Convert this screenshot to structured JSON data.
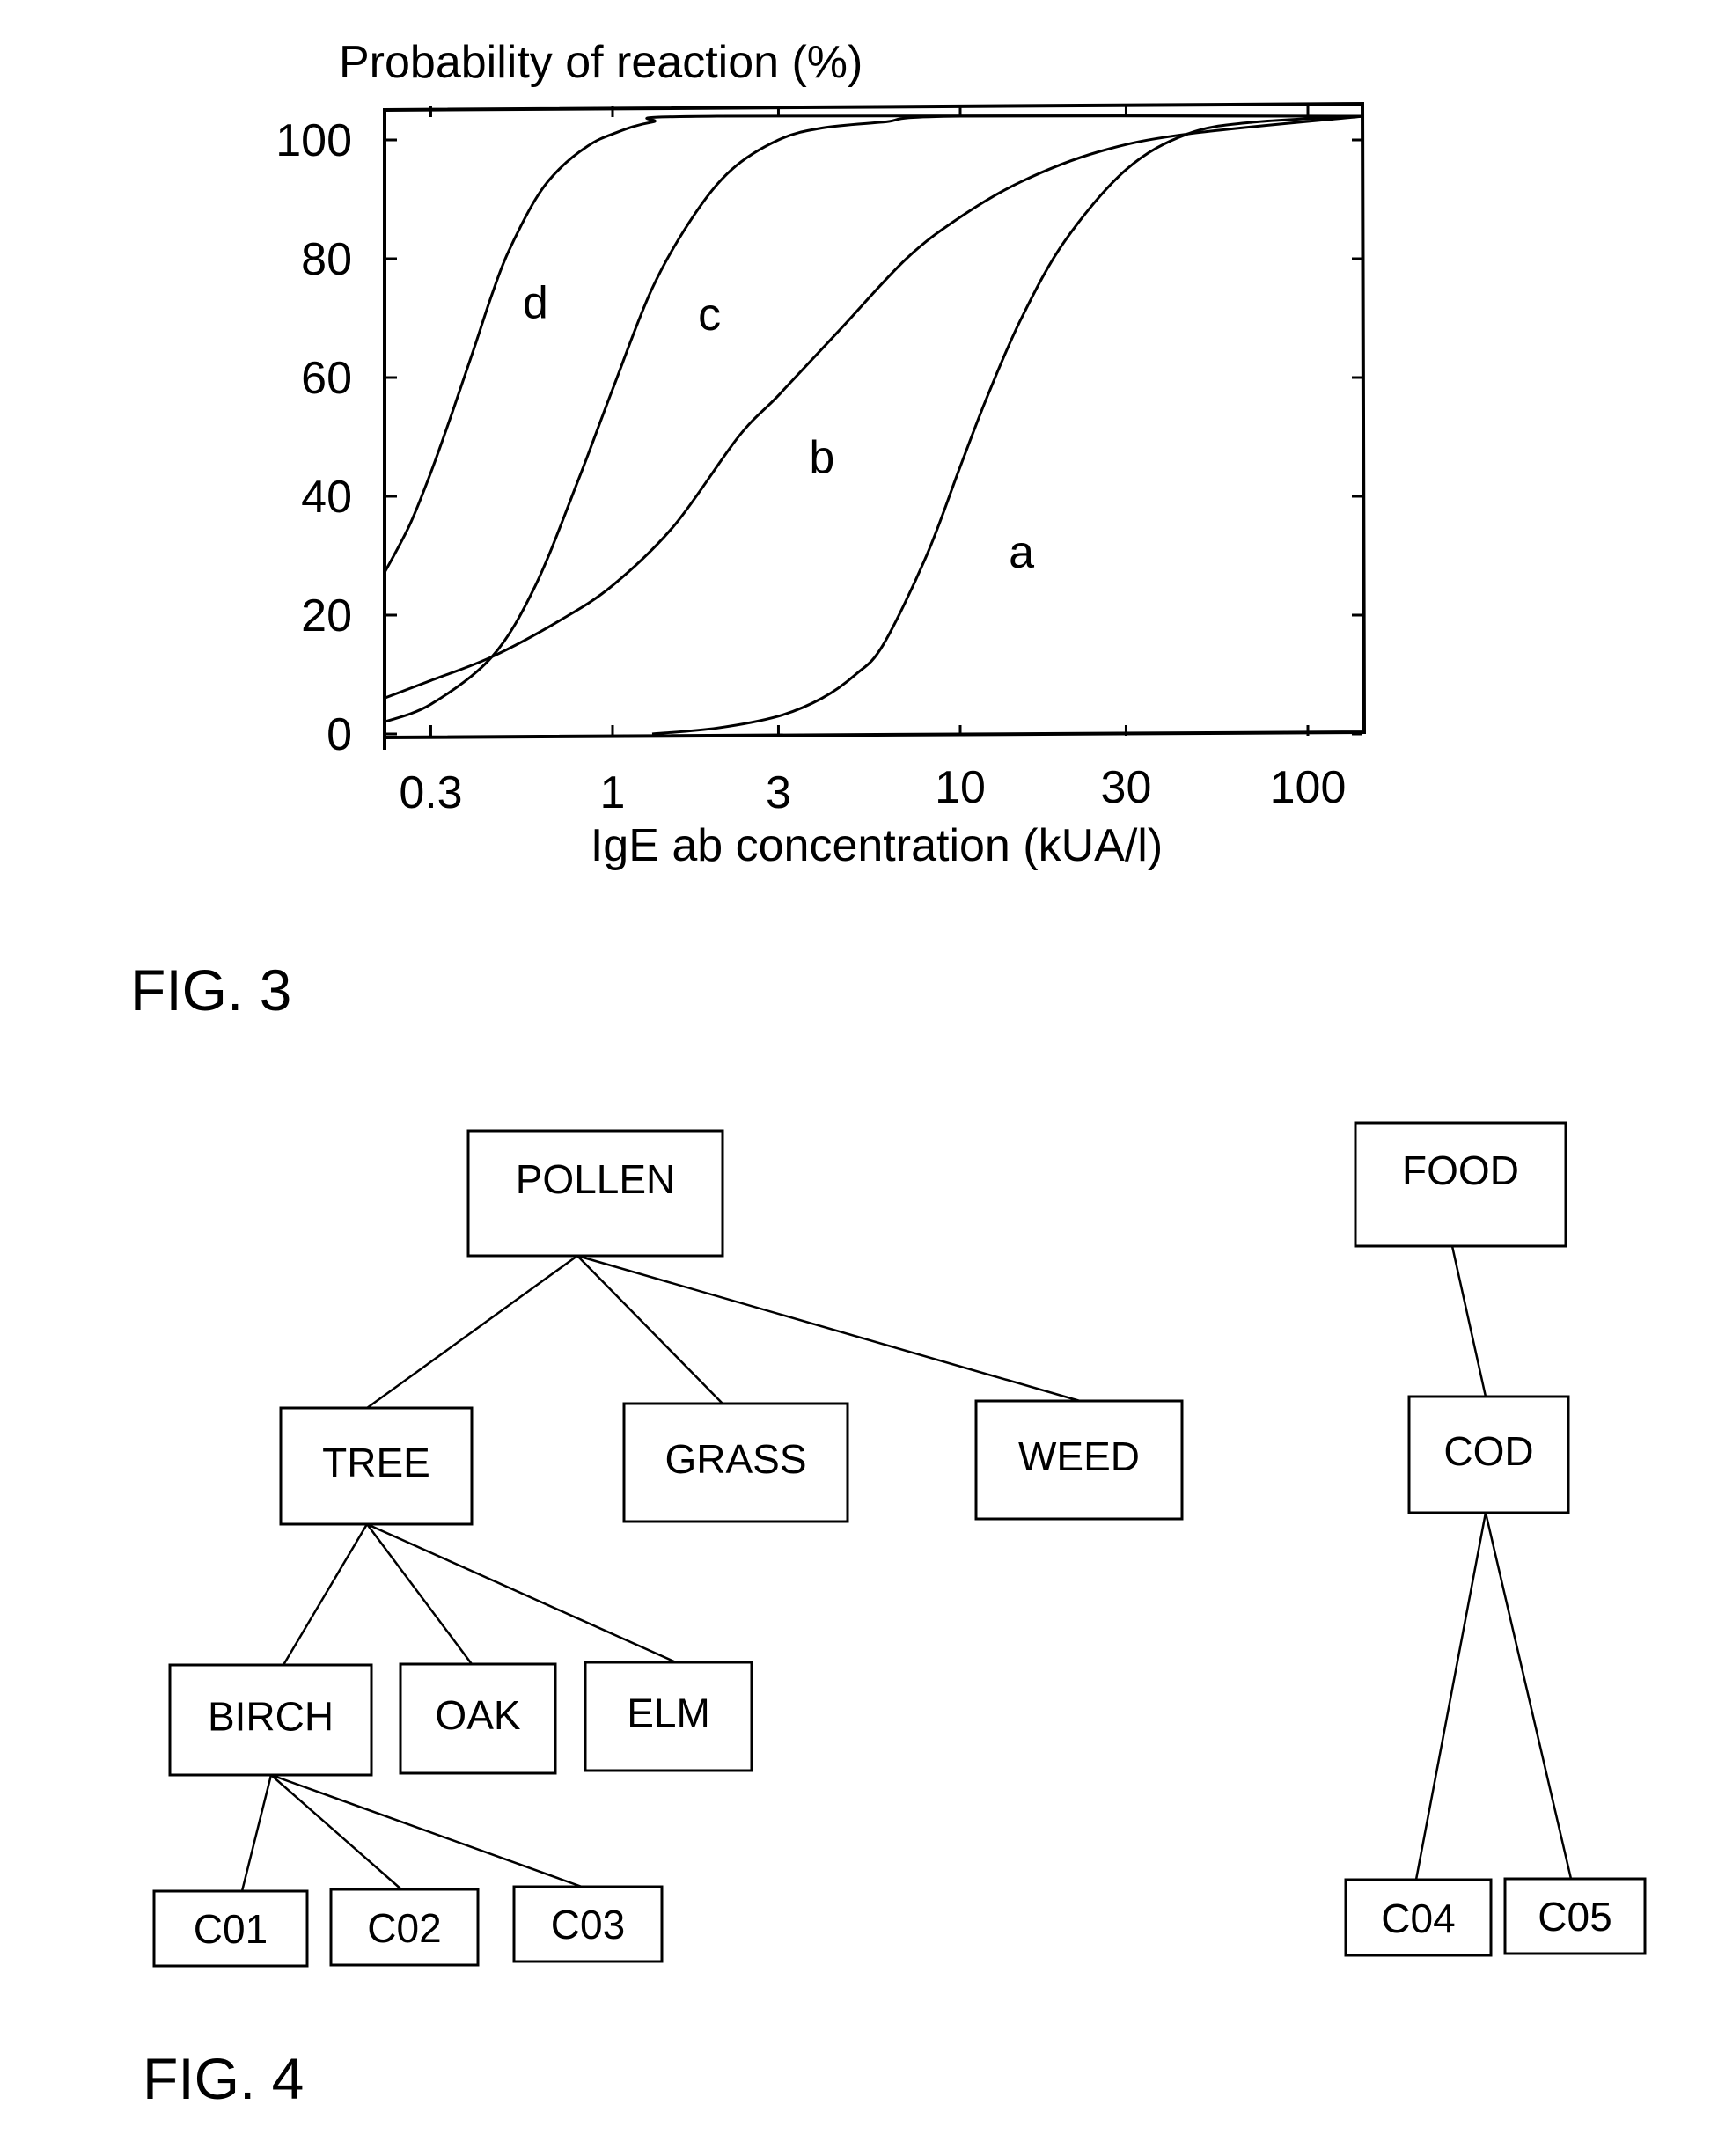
{
  "fig3": {
    "label": "FIG. 3",
    "chart_data": {
      "type": "line",
      "title": "Probability of reaction (%)",
      "xlabel": "IgE ab concentration (kUA/l)",
      "ylabel": "Probability of reaction (%)",
      "xscale": "log",
      "xlim": [
        0.22,
        145
      ],
      "ylim": [
        0,
        105
      ],
      "grid": false,
      "legend": "none (curves labeled inline)",
      "xticks": [
        0.3,
        1,
        3,
        10,
        30,
        100
      ],
      "xtick_labels": [
        "0.3",
        "1",
        "3",
        "10",
        "30",
        "100"
      ],
      "yticks": [
        0,
        20,
        40,
        60,
        80,
        100
      ],
      "ytick_labels": [
        "0",
        "20",
        "40",
        "60",
        "80",
        "100"
      ],
      "series": [
        {
          "name": "a",
          "x": [
            1.3,
            2,
            3,
            4,
            5,
            6,
            8,
            10,
            12,
            15,
            20,
            30,
            45,
            70,
            145
          ],
          "y": [
            0,
            1,
            3,
            6,
            10,
            15,
            30,
            45,
            57,
            70,
            83,
            95,
            101,
            103,
            104
          ]
        },
        {
          "name": "b",
          "x": [
            0.22,
            0.3,
            0.45,
            0.7,
            1,
            1.5,
            2.3,
            3,
            4.5,
            7,
            10,
            15,
            25,
            45,
            145
          ],
          "y": [
            6,
            9,
            13,
            19,
            25,
            35,
            50,
            57,
            68,
            80,
            87,
            93,
            98,
            101,
            104
          ]
        },
        {
          "name": "c",
          "x": [
            0.22,
            0.3,
            0.45,
            0.6,
            0.8,
            1,
            1.3,
            1.7,
            2.2,
            3,
            4,
            6,
            10,
            145
          ],
          "y": [
            2,
            5,
            13,
            25,
            43,
            58,
            75,
            87,
            95,
            100,
            102,
            103,
            104,
            104
          ]
        },
        {
          "name": "d",
          "x": [
            0.22,
            0.26,
            0.3,
            0.35,
            0.4,
            0.45,
            0.5,
            0.6,
            0.7,
            0.85,
            1,
            1.3,
            2,
            145
          ],
          "y": [
            27,
            35,
            44,
            55,
            65,
            74,
            81,
            90,
            95,
            99,
            101,
            103,
            104,
            104
          ]
        }
      ],
      "annotations": [
        {
          "text": "a",
          "x": 15,
          "y": 28
        },
        {
          "text": "b",
          "x": 4,
          "y": 44
        },
        {
          "text": "c",
          "x": 1.9,
          "y": 68
        },
        {
          "text": "d",
          "x": 0.6,
          "y": 70
        }
      ]
    }
  },
  "fig4": {
    "label": "FIG. 4",
    "nodes": {
      "pollen": "POLLEN",
      "tree": "TREE",
      "grass": "GRASS",
      "weed": "WEED",
      "birch": "BIRCH",
      "oak": "OAK",
      "elm": "ELM",
      "c01": "C01",
      "c02": "C02",
      "c03": "C03",
      "food": "FOOD",
      "cod": "COD",
      "c04": "C04",
      "c05": "C05"
    },
    "edges": [
      [
        "pollen",
        "tree"
      ],
      [
        "pollen",
        "grass"
      ],
      [
        "pollen",
        "weed"
      ],
      [
        "tree",
        "birch"
      ],
      [
        "tree",
        "oak"
      ],
      [
        "tree",
        "elm"
      ],
      [
        "birch",
        "c01"
      ],
      [
        "birch",
        "c02"
      ],
      [
        "birch",
        "c03"
      ],
      [
        "food",
        "cod"
      ],
      [
        "cod",
        "c04"
      ],
      [
        "cod",
        "c05"
      ]
    ]
  }
}
